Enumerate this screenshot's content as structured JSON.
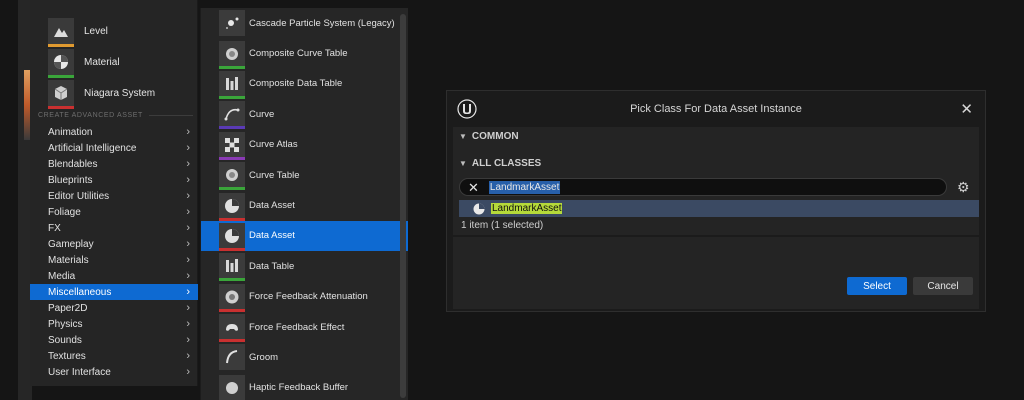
{
  "left_menu": {
    "assets": [
      {
        "label": "Level",
        "bar_color": "#e09a30",
        "icon": "level-icon"
      },
      {
        "label": "Material",
        "bar_color": "#3aa53a",
        "icon": "material-icon"
      },
      {
        "label": "Niagara System",
        "bar_color": "#c93030",
        "icon": "niagara-icon"
      }
    ],
    "section_header": "CREATE ADVANCED ASSET",
    "categories": [
      "Animation",
      "Artificial Intelligence",
      "Blendables",
      "Blueprints",
      "Editor Utilities",
      "Foliage",
      "FX",
      "Gameplay",
      "Materials",
      "Media",
      "Miscellaneous",
      "Paper2D",
      "Physics",
      "Sounds",
      "Textures",
      "User Interface"
    ],
    "active_category": "Miscellaneous"
  },
  "sub_menu": {
    "items": [
      {
        "label": "Cascade Particle System (Legacy)",
        "icon": "particle-icon",
        "bar_color": ""
      },
      {
        "label": "Composite Curve Table",
        "icon": "curve-table-icon",
        "bar_color": "#3aa53a"
      },
      {
        "label": "Composite Data Table",
        "icon": "data-table-icon",
        "bar_color": "#3aa53a"
      },
      {
        "label": "Curve",
        "icon": "curve-icon",
        "bar_color": "#5a3ab5"
      },
      {
        "label": "Curve Atlas",
        "icon": "curve-atlas-icon",
        "bar_color": "#8a3ab5"
      },
      {
        "label": "Curve Table",
        "icon": "curve-table-icon",
        "bar_color": "#3aa53a"
      },
      {
        "label": "Data Asset",
        "icon": "data-asset-icon",
        "bar_color": "#c93030"
      },
      {
        "label": "Data Asset",
        "icon": "data-asset-icon",
        "bar_color": "#c93030"
      },
      {
        "label": "Data Table",
        "icon": "data-table-icon",
        "bar_color": "#3aa53a"
      },
      {
        "label": "Force Feedback Attenuation",
        "icon": "force-feedback-icon",
        "bar_color": "#c93030"
      },
      {
        "label": "Force Feedback Effect",
        "icon": "gamepad-icon",
        "bar_color": "#c93030"
      },
      {
        "label": "Groom",
        "icon": "groom-icon",
        "bar_color": ""
      },
      {
        "label": "Haptic Feedback Buffer",
        "icon": "haptic-icon",
        "bar_color": ""
      }
    ],
    "selected_index": 7
  },
  "dialog": {
    "title": "Pick Class For Data Asset Instance",
    "group_common": "COMMON",
    "group_all": "ALL CLASSES",
    "search_value": "LandmarkAsset",
    "result_label": "LandmarkAsset",
    "count_text": "1 item (1 selected)",
    "select_label": "Select",
    "cancel_label": "Cancel"
  },
  "colors": {
    "accent": "#0e6ad2",
    "highlight": "#b5d93a",
    "result_row": "#3b4a63"
  }
}
